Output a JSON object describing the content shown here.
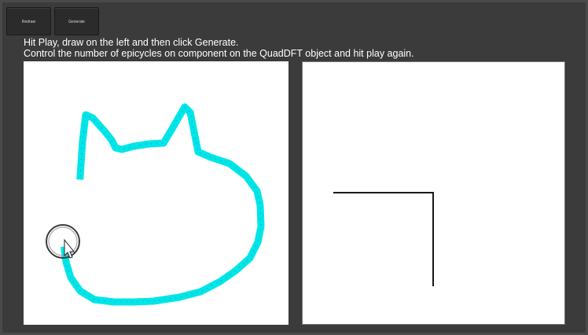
{
  "toolbar": {
    "redraw_label": "Redraw",
    "generate_label": "Generate"
  },
  "instructions": {
    "line1": "Hit Play, draw on the left and then click Generate.",
    "line2": "Control the number of epicycles on component on the QuadDFT object and hit play again."
  },
  "colors": {
    "background": "#3b3b3b",
    "stroke": "#00e5e8",
    "output_line": "#1a1a14",
    "panel": "#ffffff"
  },
  "icons": {
    "cursor": "arrow-cursor-icon",
    "brush": "circle-brush-cursor-icon"
  }
}
